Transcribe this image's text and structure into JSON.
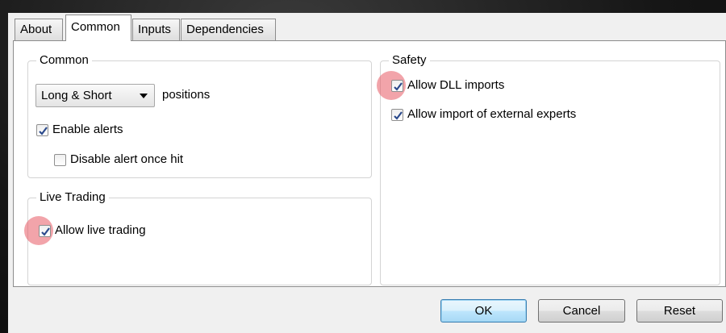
{
  "tabs": [
    {
      "label": "About"
    },
    {
      "label": "Common",
      "active": true
    },
    {
      "label": "Inputs"
    },
    {
      "label": "Dependencies"
    }
  ],
  "common_group": {
    "title": "Common",
    "positions_select": {
      "value": "Long & Short"
    },
    "positions_label": "positions",
    "enable_alerts": {
      "label": "Enable alerts",
      "checked": true
    },
    "disable_alert_once_hit": {
      "label": "Disable alert once hit",
      "checked": false
    }
  },
  "live_trading_group": {
    "title": "Live Trading",
    "allow_live_trading": {
      "label": "Allow live trading",
      "checked": true
    }
  },
  "safety_group": {
    "title": "Safety",
    "allow_dll_imports": {
      "label": "Allow DLL imports",
      "checked": true
    },
    "allow_external_experts": {
      "label": "Allow import of external experts",
      "checked": true
    }
  },
  "buttons": {
    "ok": "OK",
    "cancel": "Cancel",
    "reset": "Reset"
  },
  "colors": {
    "highlight": "#e85a64",
    "checkmark": "#2b4a8c",
    "ok_border": "#3c7fb1"
  }
}
